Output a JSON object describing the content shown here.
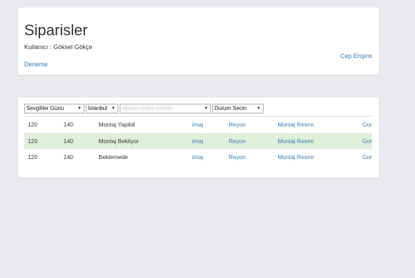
{
  "header": {
    "title": "Siparisler",
    "user_label": "Kullanıcı : Göksel Gökçe",
    "cep_link": "Cep Erişimi",
    "deneme_link": "Deneme"
  },
  "filters": {
    "occasion": "Sevgililer Günü",
    "city": "İstanbul",
    "store": "Airport Outlet Center",
    "status": "Durum Secin"
  },
  "orders": [
    {
      "col1": "120",
      "col2": "140",
      "status": "Montaj Yapildi",
      "imaj": "imaj",
      "reyon": "Reyon",
      "montaj_resmi": "Montaj Resmi",
      "gor": "Gor"
    },
    {
      "col1": "120",
      "col2": "140",
      "status": "Montaj Bekliyor",
      "imaj": "imaj",
      "reyon": "Reyon",
      "montaj_resmi": "Montaj Resmi",
      "gor": "Gor"
    },
    {
      "col1": "120",
      "col2": "140",
      "status": "Beklemede",
      "imaj": "imaj",
      "reyon": "Reyon",
      "montaj_resmi": "Montaj Resmi",
      "gor": "Gor"
    }
  ],
  "colors": {
    "background": "#e9eaed",
    "link": "#337ab7",
    "highlight_row": "#dff0d8"
  },
  "icons": {
    "dropdown": "triangle-down"
  }
}
